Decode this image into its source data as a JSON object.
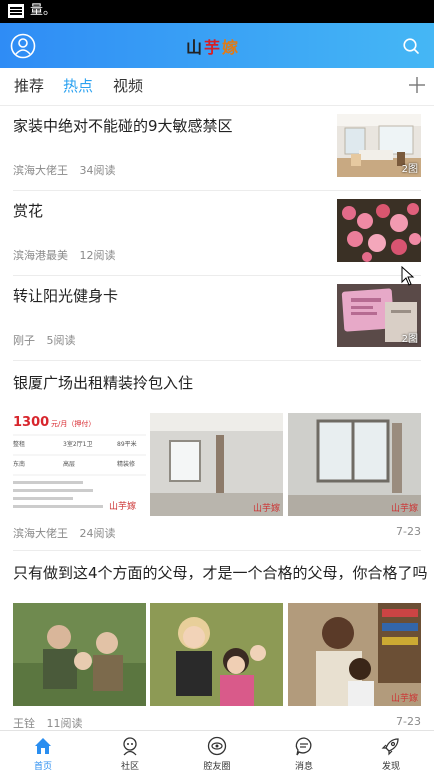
{
  "statusbar": {
    "text": "量。"
  },
  "header": {
    "logo_part1": "山",
    "logo_part2": "芋",
    "logo_part3": "嫁",
    "profile_icon": "user-circle-icon",
    "search_icon": "search-icon",
    "gradient_colors": [
      "#2f8cf5",
      "#45b7f5"
    ]
  },
  "tabs": {
    "items": [
      {
        "label": "推荐"
      },
      {
        "label": "热点"
      },
      {
        "label": "视频"
      }
    ],
    "active": "热点",
    "active_color": "#2aa1f0",
    "add_icon": "plus-icon"
  },
  "feed": [
    {
      "title": "家装中绝对不能碰的9大敏感禁区",
      "author": "滨海大佬王",
      "reads": "34阅读",
      "badge": "2图"
    },
    {
      "title": "赏花",
      "author": "滨海港最美",
      "reads": "12阅读"
    },
    {
      "title": "转让阳光健身卡",
      "author": "刚子",
      "reads": "5阅读",
      "badge": "2图"
    },
    {
      "title": "银厦广场出租精装拎包入住",
      "author": "滨海大佬王",
      "reads": "24阅读",
      "date": "7-23",
      "listing": {
        "price": "1300",
        "unit": "元/月（押付）",
        "cells": [
          "整租",
          "3室2厅1卫",
          "89平米",
          "东南",
          "高层",
          "精装修"
        ],
        "watermark": "山芋嫁"
      },
      "image_watermark": "山芋嫁"
    },
    {
      "title": "只有做到这4个方面的父母，才是一个合格的父母，你合格了吗",
      "author": "王铨",
      "reads": "11阅读",
      "date": "7-23",
      "image_watermark": "山芋嫁"
    }
  ],
  "tabbar": {
    "items": [
      {
        "label": "首页",
        "icon": "home-icon"
      },
      {
        "label": "社区",
        "icon": "community-icon"
      },
      {
        "label": "腔友圈",
        "icon": "eye-circle-icon"
      },
      {
        "label": "消息",
        "icon": "message-icon"
      },
      {
        "label": "发现",
        "icon": "rocket-icon"
      }
    ],
    "active": "首页",
    "active_color": "#2a8ef0"
  }
}
